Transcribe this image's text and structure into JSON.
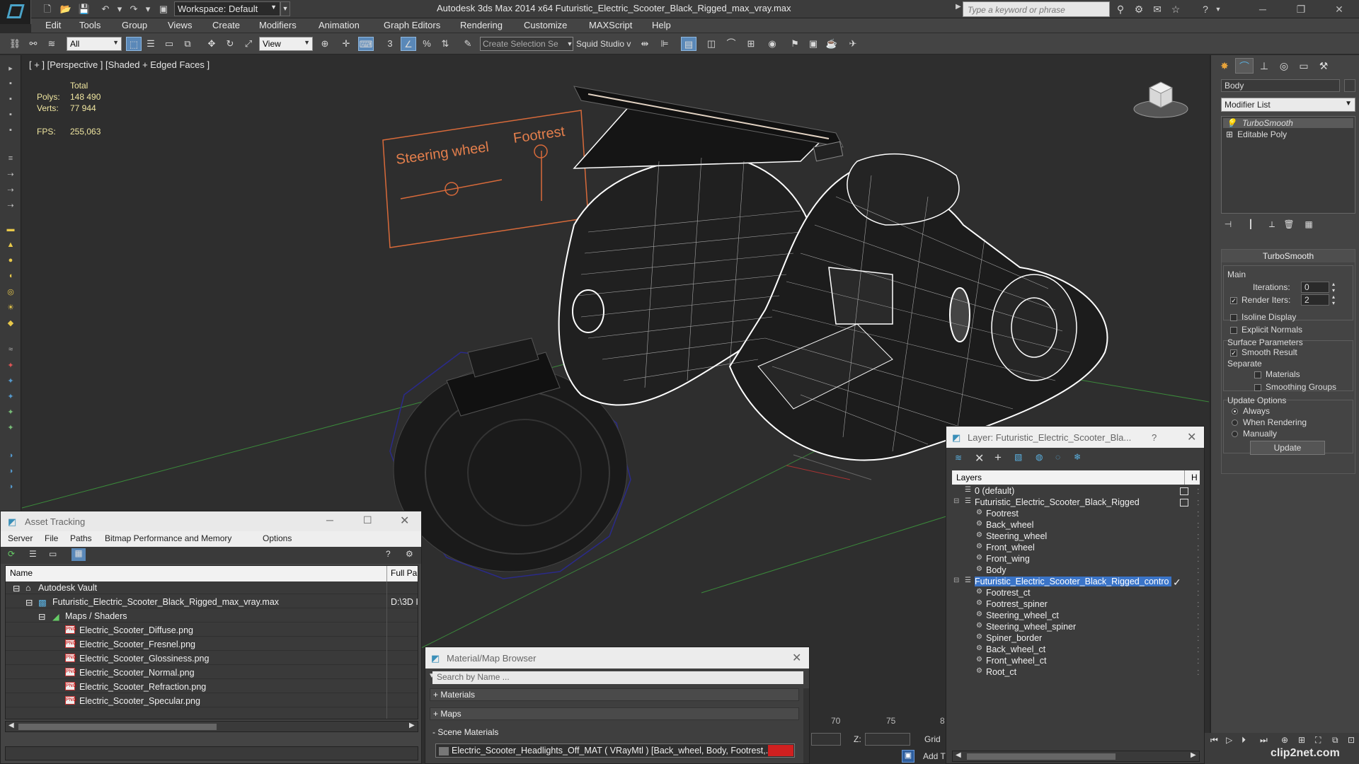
{
  "titlebar": {
    "workspace": "Workspace: Default",
    "title": "Autodesk 3ds Max  2014 x64      Futuristic_Electric_Scooter_Black_Rigged_max_vray.max",
    "search_placeholder": "Type a keyword or phrase"
  },
  "menu": [
    "Edit",
    "Tools",
    "Group",
    "Views",
    "Create",
    "Modifiers",
    "Animation",
    "Graph Editors",
    "Rendering",
    "Customize",
    "MAXScript",
    "Help"
  ],
  "toolbar": {
    "filter": "All",
    "ref_coord": "View",
    "named_selection": "Create Selection Se",
    "squid": "Squid Studio v"
  },
  "viewport": {
    "label": "[ + ] [Perspective ] [Shaded + Edged Faces ]",
    "stats": {
      "total_label": "Total",
      "polys_label": "Polys:",
      "polys_value": "148 490",
      "verts_label": "Verts:",
      "verts_value": "77 944",
      "fps_label": "FPS:",
      "fps_value": "255,063"
    },
    "panel_labels": {
      "steering": "Steering wheel",
      "footrest": "Footrest"
    }
  },
  "command_panel": {
    "object_name": "Body",
    "modifier_list": "Modifier List",
    "stack": [
      "TurboSmooth",
      "Editable Poly"
    ],
    "turbosmooth": {
      "title": "TurboSmooth",
      "main": "Main",
      "iterations_label": "Iterations:",
      "iterations_value": "0",
      "render_iters_label": "Render Iters:",
      "render_iters_value": "2",
      "isoline": "Isoline Display",
      "explicit_normals": "Explicit Normals",
      "surface_params": "Surface Parameters",
      "smooth_result": "Smooth Result",
      "separate": "Separate",
      "materials": "Materials",
      "smoothing_groups": "Smoothing Groups",
      "update_options": "Update Options",
      "always": "Always",
      "when_rendering": "When Rendering",
      "manually": "Manually",
      "update": "Update"
    }
  },
  "asset_tracking": {
    "title": "Asset Tracking",
    "menu": [
      "Server",
      "File",
      "Paths",
      "Bitmap Performance and Memory",
      "Options"
    ],
    "col_name": "Name",
    "col_path": "Full Pa",
    "rows": [
      {
        "name": "Autodesk Vault",
        "path": ""
      },
      {
        "name": "Futuristic_Electric_Scooter_Black_Rigged_max_vray.max",
        "path": "D:\\3D I"
      },
      {
        "name": "Maps / Shaders",
        "path": ""
      },
      {
        "name": "Electric_Scooter_Diffuse.png",
        "path": ""
      },
      {
        "name": "Electric_Scooter_Fresnel.png",
        "path": ""
      },
      {
        "name": "Electric_Scooter_Glossiness.png",
        "path": ""
      },
      {
        "name": "Electric_Scooter_Normal.png",
        "path": ""
      },
      {
        "name": "Electric_Scooter_Refraction.png",
        "path": ""
      },
      {
        "name": "Electric_Scooter_Specular.png",
        "path": ""
      }
    ]
  },
  "material_browser": {
    "title": "Material/Map Browser",
    "search": "Search by Name ...",
    "categories": [
      "+ Materials",
      "+ Maps",
      "- Scene Materials"
    ],
    "material": "Electric_Scooter_Headlights_Off_MAT ( VRayMtl ) [Back_wheel, Body, Footrest,..."
  },
  "layer_explorer": {
    "title": "Layer: Futuristic_Electric_Scooter_Bla...",
    "help": "?",
    "col_layers": "Layers",
    "col_h": "H",
    "rows": [
      {
        "name": "0 (default)"
      },
      {
        "name": "Futuristic_Electric_Scooter_Black_Rigged"
      },
      {
        "name": "Footrest"
      },
      {
        "name": "Back_wheel"
      },
      {
        "name": "Steering_wheel"
      },
      {
        "name": "Front_wheel"
      },
      {
        "name": "Front_wing"
      },
      {
        "name": "Body"
      },
      {
        "name": "Futuristic_Electric_Scooter_Black_Rigged_contro"
      },
      {
        "name": "Footrest_ct"
      },
      {
        "name": "Footrest_spiner"
      },
      {
        "name": "Steering_wheel_ct"
      },
      {
        "name": "Steering_wheel_spiner"
      },
      {
        "name": "Spiner_border"
      },
      {
        "name": "Back_wheel_ct"
      },
      {
        "name": "Front_wheel_ct"
      },
      {
        "name": "Root_ct"
      }
    ]
  },
  "timeline": {
    "t70": "70",
    "t75": "75",
    "t8": "8",
    "z_label": "Z:",
    "grid": "Grid",
    "add_t": "Add T"
  },
  "watermark": "clip2net.com"
}
